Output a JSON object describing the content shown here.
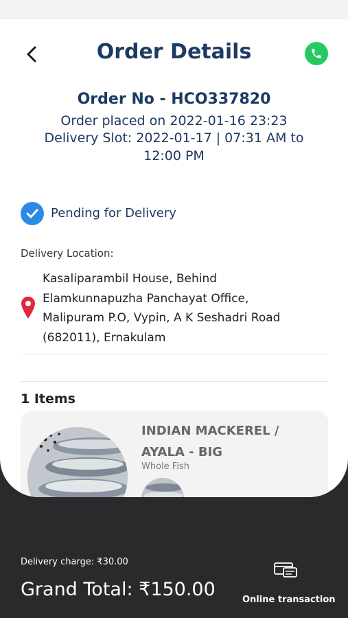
{
  "header": {
    "title": "Order Details",
    "back_icon": "chevron-left-icon",
    "call_icon": "phone-icon"
  },
  "order": {
    "number_line": "Order No - HCO337820",
    "placed_line": "Order placed on 2022-01-16 23:23",
    "slot_line_1": "Delivery Slot: 2022-01-17 | 07:31 AM to",
    "slot_line_2": "12:00 PM"
  },
  "status": {
    "text": "Pending for Delivery",
    "icon": "check-circle-icon"
  },
  "delivery": {
    "label": "Delivery Location:",
    "address_lines": [
      "Kasaliparambil House, Behind",
      "Elamkunnapuzha Panchayat Office,",
      "Malipuram P.O, Vypin, A K Seshadri Road",
      "(682011), Ernakulam"
    ],
    "icon": "location-pin-icon"
  },
  "items": {
    "count_label": "1 Items",
    "list": [
      {
        "name": "INDIAN MACKEREL / AYALA - BIG",
        "type": "Whole Fish"
      }
    ]
  },
  "footer": {
    "delivery_charge": "Delivery charge: ₹30.00",
    "grand_total": "Grand Total: ₹150.00",
    "payment_method": "Online transaction",
    "payment_icon": "card-icon"
  },
  "colors": {
    "primary_navy": "#1d3a63",
    "call_green": "#25c95f",
    "status_blue": "#2b8ae6",
    "pin_red": "#e0283c",
    "footer_dark": "#2a2a2c"
  }
}
